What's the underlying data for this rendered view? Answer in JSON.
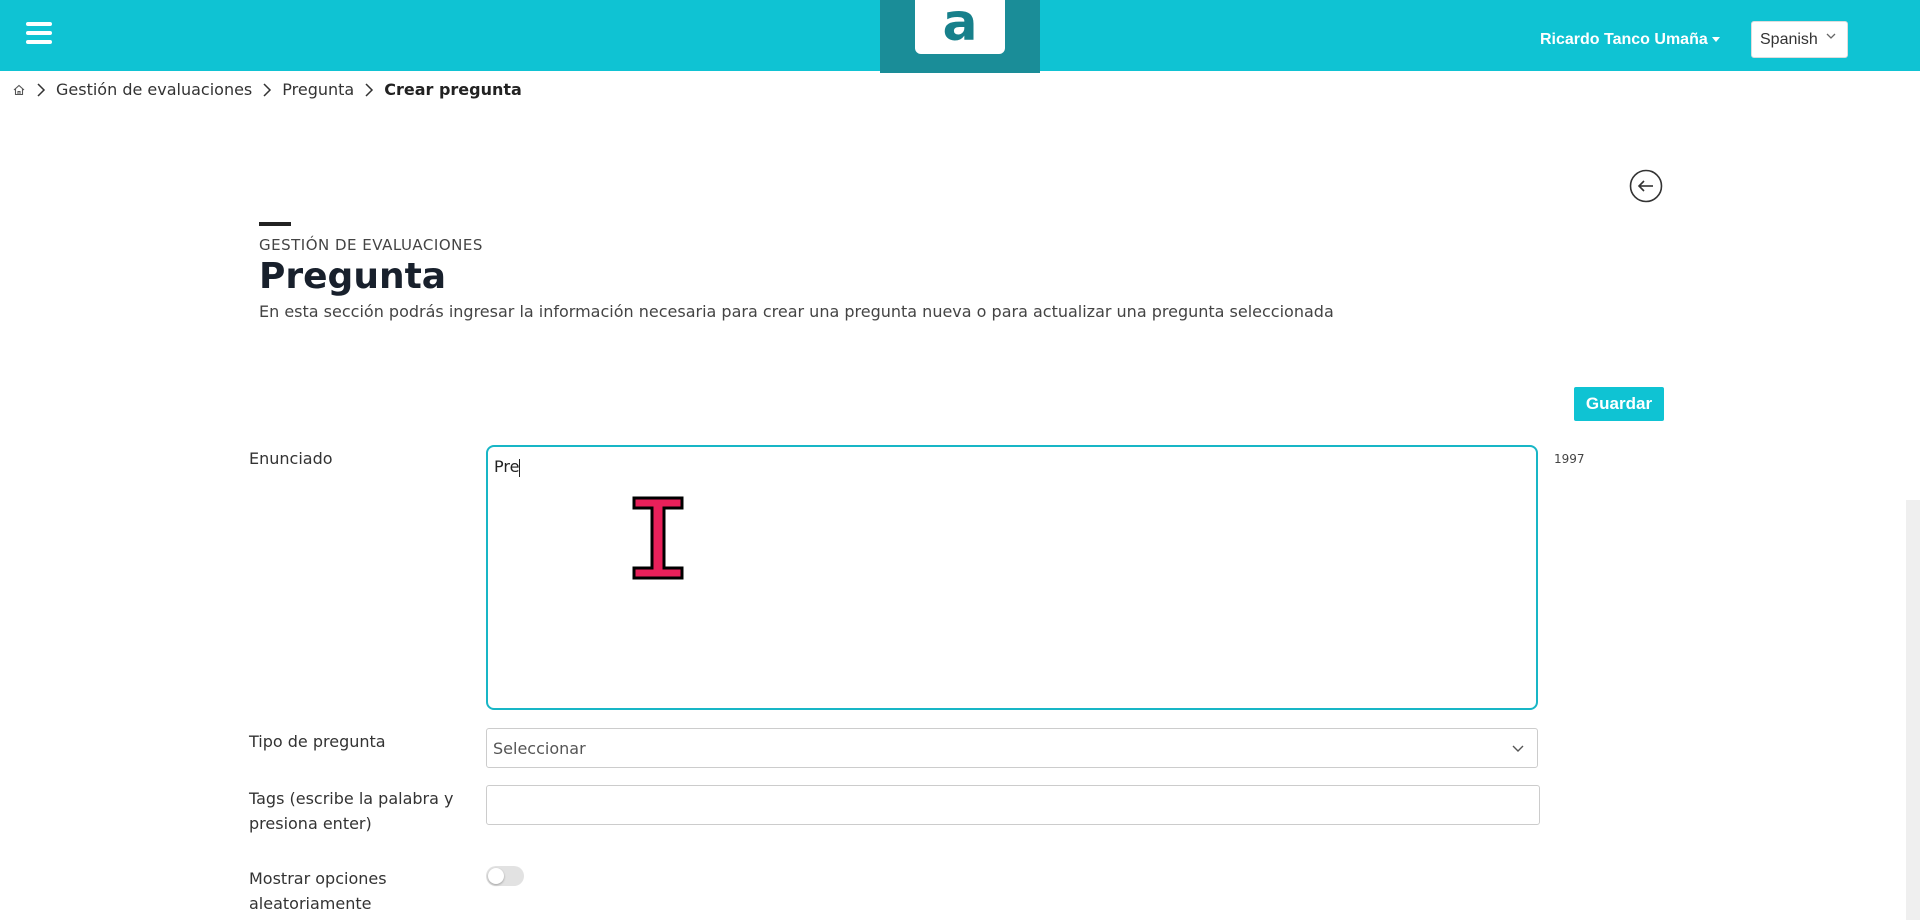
{
  "header": {
    "logo_letter": "a",
    "user_name": "Ricardo Tanco Umaña",
    "language": "Spanish"
  },
  "breadcrumb": {
    "items": [
      "Gestión de evaluaciones",
      "Pregunta"
    ],
    "current": "Crear pregunta"
  },
  "page": {
    "overline": "GESTIÓN DE EVALUACIONES",
    "title": "Pregunta",
    "description": "En esta sección podrás ingresar la información necesaria para crear una pregunta nueva o para actualizar una pregunta seleccionada"
  },
  "form": {
    "save_label": "Guardar",
    "statement_label": "Enunciado",
    "statement_value": "Pre",
    "char_count": "1997",
    "type_label": "Tipo de pregunta",
    "type_value": "Seleccionar",
    "tags_label_1": "Tags (escribe la palabra y",
    "tags_label_2": "presiona enter)",
    "random_label_1": "Mostrar opciones",
    "random_label_2": "aleatoriamente",
    "random_enabled": false
  },
  "colors": {
    "accent": "#0fc3d3",
    "logo_bg": "#1a8d98"
  }
}
